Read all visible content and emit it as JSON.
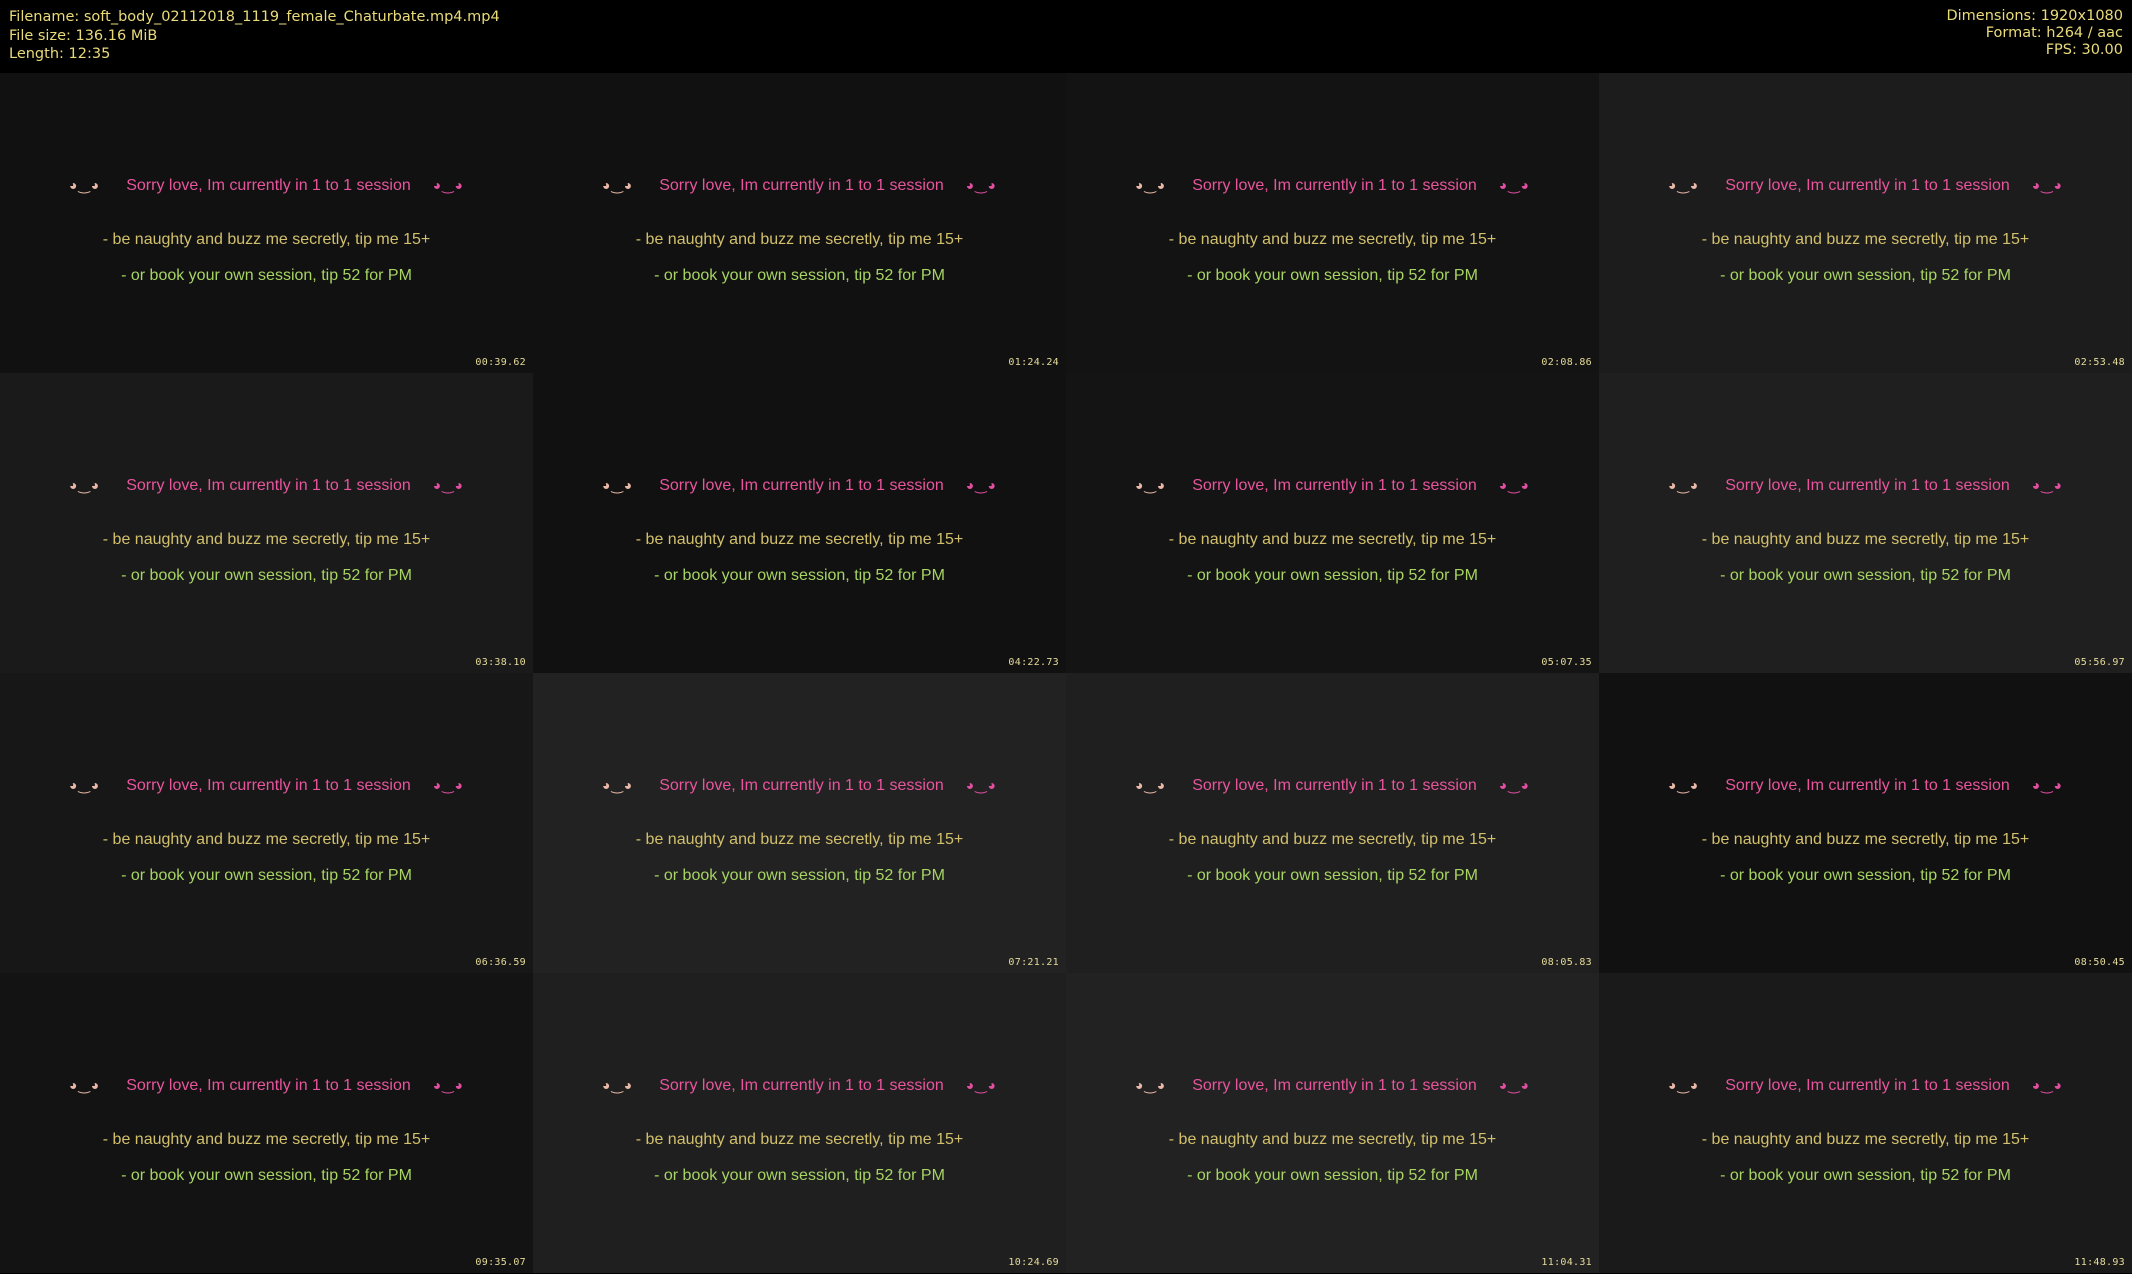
{
  "header": {
    "filename": "Filename: soft_body_02112018_1119_female_Chaturbate.mp4.mp4",
    "filesize": "File size: 136.16 MiB",
    "length": "Length: 12:35",
    "dimensions": "Dimensions: 1920x1080",
    "format": "Format: h264 / aac",
    "fps": "FPS: 30.00"
  },
  "overlay": {
    "emoticon_left": "◕‿◕",
    "emoticon_right": "◕‿◕",
    "line1": "Sorry love, Im currently in 1 to 1 session",
    "line2": "- be naughty and buzz me secretly, tip me 15+",
    "line3": "- or book your own session, tip 52 for PM"
  },
  "thumbnails": [
    {
      "timestamp": "00:39.62",
      "bg": "#111111"
    },
    {
      "timestamp": "01:24.24",
      "bg": "#111111"
    },
    {
      "timestamp": "02:08.86",
      "bg": "#131313"
    },
    {
      "timestamp": "02:53.48",
      "bg": "#1c1c1c"
    },
    {
      "timestamp": "03:38.10",
      "bg": "#1a1a1a"
    },
    {
      "timestamp": "04:22.73",
      "bg": "#111111"
    },
    {
      "timestamp": "05:07.35",
      "bg": "#141414"
    },
    {
      "timestamp": "05:56.97",
      "bg": "#1f1f1f"
    },
    {
      "timestamp": "06:36.59",
      "bg": "#171717"
    },
    {
      "timestamp": "07:21.21",
      "bg": "#222222"
    },
    {
      "timestamp": "08:05.83",
      "bg": "#1f1f1f"
    },
    {
      "timestamp": "08:50.45",
      "bg": "#111111"
    },
    {
      "timestamp": "09:35.07",
      "bg": "#131313"
    },
    {
      "timestamp": "10:24.69",
      "bg": "#1f1f1f"
    },
    {
      "timestamp": "11:04.31",
      "bg": "#222222"
    },
    {
      "timestamp": "11:48.93",
      "bg": "#1a1a1a"
    }
  ]
}
